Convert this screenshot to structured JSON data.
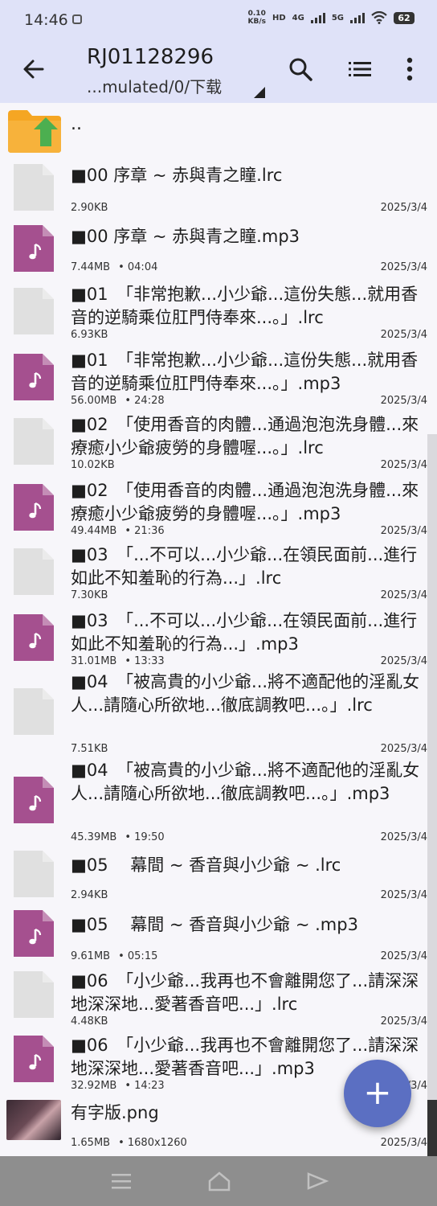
{
  "status_bar": {
    "time": "14:46",
    "net_speed_value": "0.10",
    "net_speed_unit": "KB/s",
    "hd_label": "HD",
    "sig1_label": "4G",
    "sig2_label": "5G",
    "battery": "62"
  },
  "app_bar": {
    "title": "RJ01128296",
    "path": "...mulated/0/下载"
  },
  "parent_entry": {
    "label": ".."
  },
  "files": [
    {
      "name": "■00 序章 ~ 赤與青之瞳.lrc",
      "size": "2.90KB",
      "extra": "",
      "date": "2025/3/4",
      "type": "doc"
    },
    {
      "name": "■00 序章 ~ 赤與青之瞳.mp3",
      "size": "7.44MB",
      "extra": "• 04:04",
      "date": "2025/3/4",
      "type": "audio"
    },
    {
      "name": "■01　「非常抱歉...小少爺...這份失態...就用香音的逆騎乘位肛門侍奉來...。」.lrc",
      "size": "6.93KB",
      "extra": "",
      "date": "2025/3/4",
      "type": "doc"
    },
    {
      "name": "■01　「非常抱歉...小少爺...這份失態...就用香音的逆騎乘位肛門侍奉來...。」.mp3",
      "size": "56.00MB",
      "extra": "• 24:28",
      "date": "2025/3/4",
      "type": "audio"
    },
    {
      "name": "■02　「使用香音的肉體...通過泡泡洗身體...來療癒小少爺疲勞的身體喔...。」.lrc",
      "size": "10.02KB",
      "extra": "",
      "date": "2025/3/4",
      "type": "doc"
    },
    {
      "name": "■02　「使用香音的肉體...通過泡泡洗身體...來療癒小少爺疲勞的身體喔...。」.mp3",
      "size": "49.44MB",
      "extra": "• 21:36",
      "date": "2025/3/4",
      "type": "audio"
    },
    {
      "name": "■03　「...不可以...小少爺...在領民面前...進行如此不知羞恥的行為...」.lrc",
      "size": "7.30KB",
      "extra": "",
      "date": "2025/3/4",
      "type": "doc"
    },
    {
      "name": "■03　「...不可以...小少爺...在領民面前...進行如此不知羞恥的行為...」.mp3",
      "size": "31.01MB",
      "extra": "• 13:33",
      "date": "2025/3/4",
      "type": "audio"
    },
    {
      "name": "■04　「被高貴的小少爺...將不適配他的淫亂女人...請隨心所欲地...徹底調教吧...。」.lrc",
      "size": "7.51KB",
      "extra": "",
      "date": "2025/3/4",
      "type": "doc"
    },
    {
      "name": "■04　「被高貴的小少爺...將不適配他的淫亂女人...請隨心所欲地...徹底調教吧...。」.mp3",
      "size": "45.39MB",
      "extra": "• 19:50",
      "date": "2025/3/4",
      "type": "audio"
    },
    {
      "name": "■05　 幕間 ~ 香音與小少爺 ~ .lrc",
      "size": "2.94KB",
      "extra": "",
      "date": "2025/3/4",
      "type": "doc"
    },
    {
      "name": "■05　 幕間 ~ 香音與小少爺 ~ .mp3",
      "size": "9.61MB",
      "extra": "• 05:15",
      "date": "2025/3/4",
      "type": "audio"
    },
    {
      "name": "■06　「小少爺...我再也不會離開您了...請深深地深深地...愛著香音吧...」.lrc",
      "size": "4.48KB",
      "extra": "",
      "date": "2025/3/4",
      "type": "doc"
    },
    {
      "name": "■06　「小少爺...我再也不會離開您了...請深深地深深地...愛著香音吧...」.mp3",
      "size": "32.92MB",
      "extra": "• 14:23",
      "date": "2025/3/4",
      "type": "audio"
    },
    {
      "name": "有字版.png",
      "size": "1.65MB",
      "extra": "• 1680x1260",
      "date": "2025/3/4",
      "type": "image"
    }
  ],
  "fab": {
    "symbol": "+"
  },
  "colors": {
    "app_bar": "#dfe2f8",
    "audio_icon": "#a5508f",
    "doc_icon": "#e0e0e0",
    "folder": "#f5a623",
    "folder_arrow": "#4caf50",
    "fab": "#5b6fc2"
  }
}
